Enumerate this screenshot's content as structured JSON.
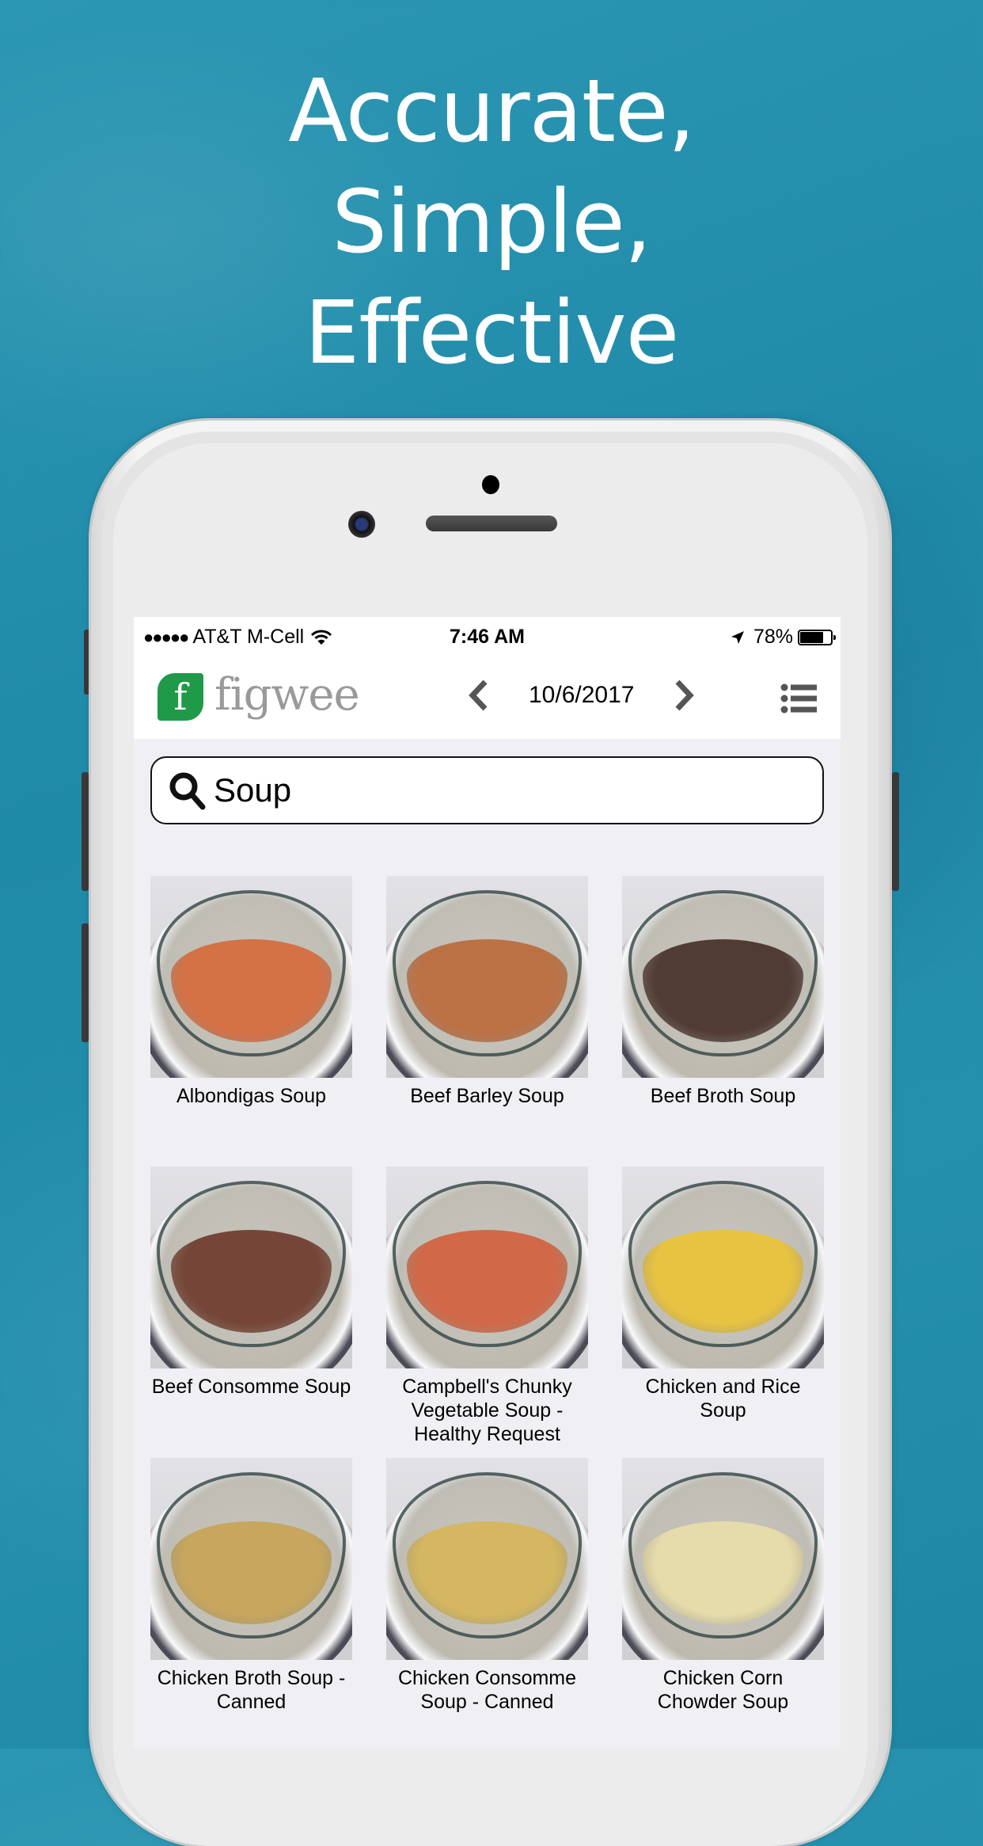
{
  "tagline": [
    "Accurate,",
    "Simple,",
    "Effective"
  ],
  "status_bar": {
    "signal_dots": "●●●●●",
    "carrier": "AT&T M-Cell",
    "time": "7:46 AM",
    "location_icon": "location-arrow-icon",
    "battery_percent": "78%",
    "battery_level": 0.78
  },
  "header": {
    "logo_mark": "f",
    "logo_text": "figwee",
    "date": "10/6/2017",
    "prev_icon": "chevron-left-icon",
    "next_icon": "chevron-right-icon",
    "menu_icon": "list-menu-icon"
  },
  "search": {
    "value": "Soup",
    "icon": "search-icon"
  },
  "colors": {
    "brand_green": "#1f9a48",
    "logo_text": "#9a9a9a",
    "screen_bg": "#efeff4",
    "background_water": "#2590ae"
  },
  "results": [
    {
      "label": "Albondigas Soup",
      "liquid": "#d9531a"
    },
    {
      "label": "Beef Barley Soup",
      "liquid": "#b8531a"
    },
    {
      "label": "Beef Broth Soup",
      "liquid": "#2a0d05"
    },
    {
      "label": "Beef Consomme Soup",
      "liquid": "#5a1a08"
    },
    {
      "label": "Campbell's Chunky Vegetable Soup - Healthy Request",
      "liquid": "#d4481e"
    },
    {
      "label": "Chicken and Rice Soup",
      "liquid": "#f2c014"
    },
    {
      "label": "Chicken Broth Soup - Canned",
      "liquid": "#c89a3a"
    },
    {
      "label": "Chicken Consomme Soup - Canned",
      "liquid": "#d8b03e"
    },
    {
      "label": "Chicken Corn Chowder Soup",
      "liquid": "#f0e0a0"
    }
  ]
}
